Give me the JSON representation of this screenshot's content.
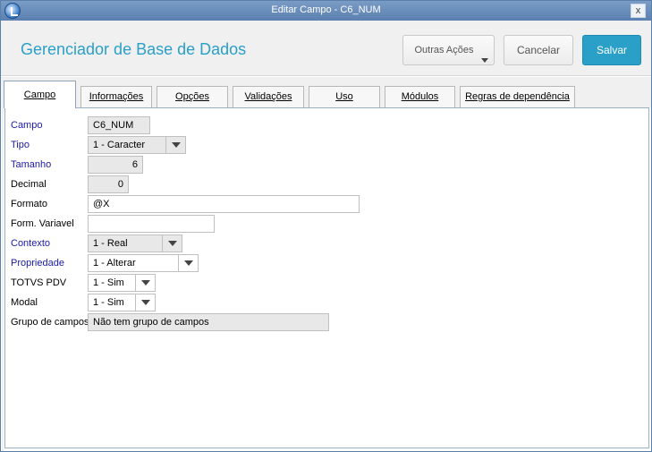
{
  "window": {
    "title": "Editar Campo - C6_NUM",
    "close_glyph": "x"
  },
  "header": {
    "app_title": "Gerenciador de Base de Dados",
    "buttons": {
      "outras_acoes": "Outras Ações",
      "cancelar": "Cancelar",
      "salvar": "Salvar"
    }
  },
  "tabs": [
    {
      "label": "Campo",
      "active": true
    },
    {
      "label": "Informações"
    },
    {
      "label": "Opções"
    },
    {
      "label": "Validações"
    },
    {
      "label": "Uso"
    },
    {
      "label": "Módulos"
    },
    {
      "label": "Regras de dependência"
    }
  ],
  "form": {
    "campo": {
      "label": "Campo",
      "value": "C6_NUM"
    },
    "tipo": {
      "label": "Tipo",
      "value": "1 - Caracter"
    },
    "tamanho": {
      "label": "Tamanho",
      "value": "6"
    },
    "decimal": {
      "label": "Decimal",
      "value": "0"
    },
    "formato": {
      "label": "Formato",
      "value": "@X"
    },
    "form_variavel": {
      "label": "Form. Variavel",
      "value": ""
    },
    "contexto": {
      "label": "Contexto",
      "value": "1 - Real"
    },
    "propriedade": {
      "label": "Propriedade",
      "value": "1 - Alterar"
    },
    "totvs_pdv": {
      "label": "TOTVS PDV",
      "value": "1 - Sim"
    },
    "modal": {
      "label": "Modal",
      "value": "1 - Sim"
    },
    "grupo_campos": {
      "label": "Grupo de campos",
      "value": "Não tem grupo de campos"
    }
  },
  "colors": {
    "accent": "#2a9fc7",
    "required_label": "#1a1aa8",
    "titlebar": "#5b80b0"
  },
  "icons": {
    "app": "totvs-logo-icon",
    "close": "close-icon",
    "dropdown": "chevron-down-icon"
  }
}
